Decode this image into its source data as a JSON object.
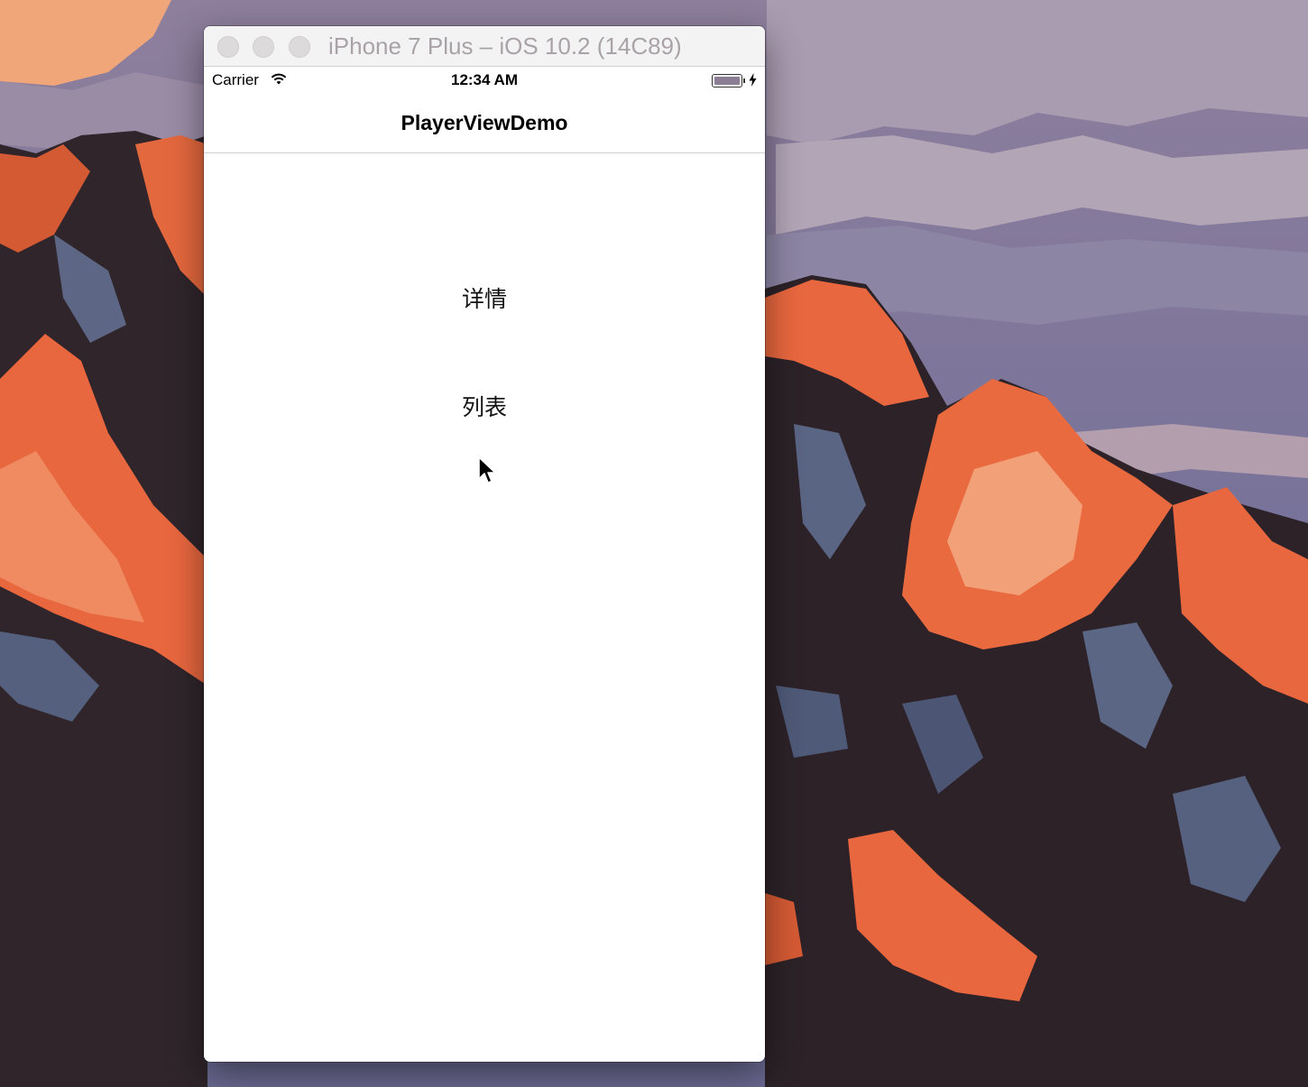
{
  "window": {
    "title": "iPhone 7 Plus – iOS 10.2 (14C89)",
    "traffic_lights": [
      "close",
      "minimize",
      "zoom"
    ]
  },
  "status_bar": {
    "carrier": "Carrier",
    "time": "12:34 AM",
    "wifi_icon": "wifi-icon",
    "battery_icon": "battery-icon",
    "charging_icon": "bolt-icon"
  },
  "nav_bar": {
    "title": "PlayerViewDemo"
  },
  "menu": {
    "items": [
      {
        "label": "详情"
      },
      {
        "label": "列表"
      }
    ]
  },
  "colors": {
    "desktop_sky": "#7a6f92",
    "mountain_orange": "#e8673f",
    "mountain_dark": "#2e2328",
    "window_bg": "#ffffff"
  }
}
